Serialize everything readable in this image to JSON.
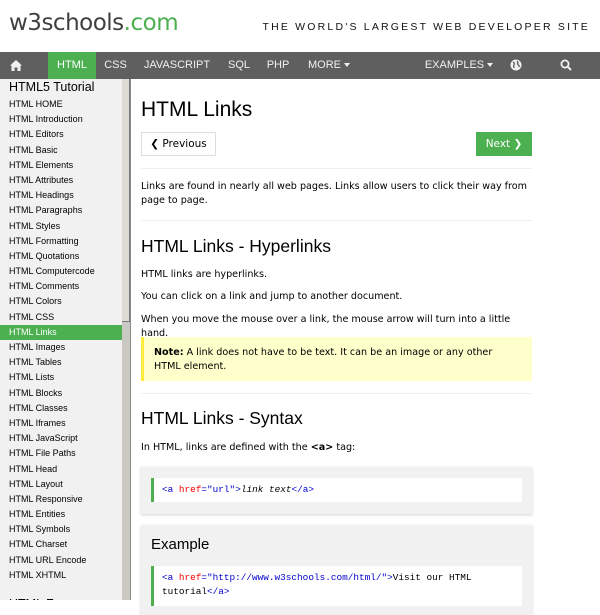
{
  "header": {
    "logo_main": "w3schools",
    "logo_suffix": ".com",
    "tagline": "THE WORLD'S LARGEST WEB DEVELOPER SITE"
  },
  "nav": {
    "home_icon": "home-icon",
    "items": [
      {
        "label": "HTML",
        "active": true
      },
      {
        "label": "CSS"
      },
      {
        "label": "JAVASCRIPT"
      },
      {
        "label": "SQL"
      },
      {
        "label": "PHP"
      },
      {
        "label": "MORE"
      }
    ],
    "examples_label": "EXAMPLES",
    "globe_icon": "globe-icon",
    "search_icon": "search-icon"
  },
  "sidebar": {
    "title": "HTML5 Tutorial",
    "items": [
      "HTML HOME",
      "HTML Introduction",
      "HTML Editors",
      "HTML Basic",
      "HTML Elements",
      "HTML Attributes",
      "HTML Headings",
      "HTML Paragraphs",
      "HTML Styles",
      "HTML Formatting",
      "HTML Quotations",
      "HTML Computercode",
      "HTML Comments",
      "HTML Colors",
      "HTML CSS",
      "HTML Links",
      "HTML Images",
      "HTML Tables",
      "HTML Lists",
      "HTML Blocks",
      "HTML Classes",
      "HTML Iframes",
      "HTML JavaScript",
      "HTML File Paths",
      "HTML Head",
      "HTML Layout",
      "HTML Responsive",
      "HTML Entities",
      "HTML Symbols",
      "HTML Charset",
      "HTML URL Encode",
      "HTML XHTML"
    ],
    "active_index": 15,
    "next_section_partial": "HTML Forms"
  },
  "main": {
    "title": "HTML Links",
    "prev_label": "❮ Previous",
    "next_label": "Next ❯",
    "intro": "Links are found in nearly all web pages. Links allow users to click their way from page to page.",
    "section1": {
      "heading": "HTML Links - Hyperlinks",
      "p1": "HTML links are hyperlinks.",
      "p2": "You can click on a link and jump to another document.",
      "p3": "When you move the mouse over a link, the mouse arrow will turn into a little hand."
    },
    "note": {
      "label": "Note:",
      "text": " A link does not have to be text. It can be an image or any other HTML element."
    },
    "section2": {
      "heading": "HTML Links - Syntax",
      "p_before": "In HTML, links are defined with the ",
      "p_tag": "<a>",
      "p_after": " tag:",
      "code": {
        "open": "<a",
        "attr": " href",
        "eq": "=",
        "val": "\"url\"",
        "close": ">",
        "text": "link text",
        "end": "</a>"
      }
    },
    "example": {
      "title": "Example",
      "code": {
        "open": "<a",
        "attr": " href",
        "eq": "=",
        "val": "\"http://www.w3schools.com/html/\"",
        "close": ">",
        "text_line1": "Visit our HTML",
        "text_line2": "tutorial",
        "end": "</a>"
      }
    }
  },
  "colors": {
    "brand_green": "#4CAF50",
    "nav_bg": "#5f5f5f",
    "sidebar_bg": "#f1f1f1",
    "note_bg": "#ffffcc",
    "note_border": "#ffeb3b"
  }
}
